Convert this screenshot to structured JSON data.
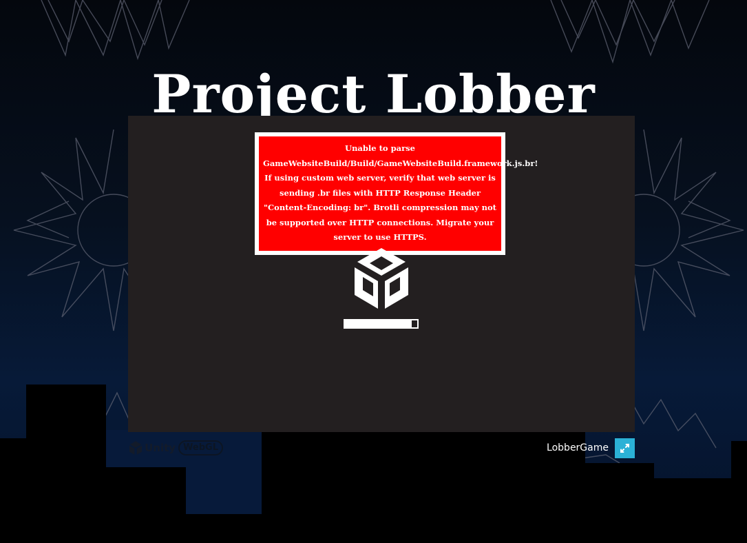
{
  "page": {
    "title": "Project Lobber"
  },
  "unity": {
    "warning": {
      "message": "Unable to parse GameWebsiteBuild/Build/GameWebsiteBuild.framework.js.br! If using custom web server, verify that web server is sending .br files with HTTP Response Header \"Content-Encoding: br\". Brotli compression may not be supported over HTTP connections. Migrate your server to use HTTPS."
    },
    "loading": {
      "progress": 0.92
    },
    "footer": {
      "logo_unity_text": "Unity",
      "logo_webgl_text": "WebGL",
      "build_title": "LobberGame"
    }
  },
  "colors": {
    "background": "#050b16",
    "container": "#231f20",
    "warning": "#ff0000",
    "fullscreen": "#2bb1d6"
  }
}
